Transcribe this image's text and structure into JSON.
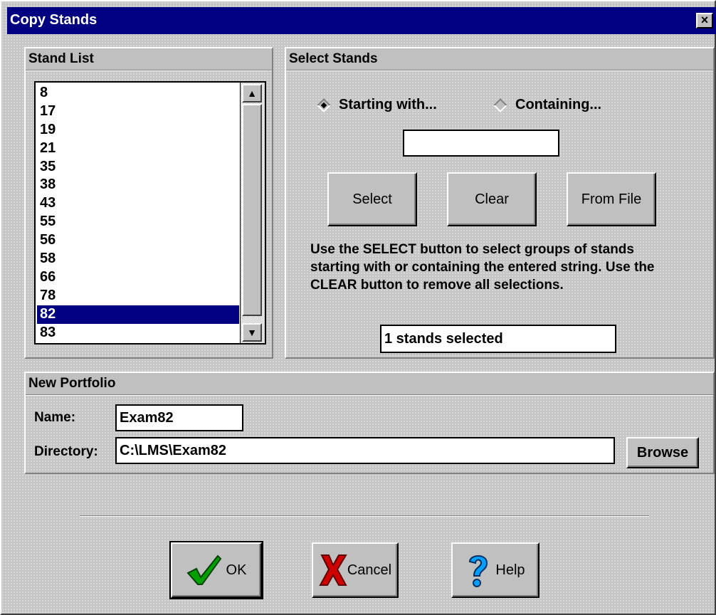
{
  "window": {
    "title": "Copy Stands",
    "close": "×"
  },
  "stand_list": {
    "header": "Stand List",
    "items": [
      "8",
      "17",
      "19",
      "21",
      "35",
      "38",
      "43",
      "55",
      "56",
      "58",
      "66",
      "78",
      "82",
      "83"
    ],
    "selected": "82"
  },
  "select_stands": {
    "header": "Select Stands",
    "radio_starting": "Starting with...",
    "radio_containing": "Containing...",
    "search_value": "",
    "select_label": "Select",
    "clear_label": "Clear",
    "from_file_label": "From File",
    "help_text": "Use the SELECT button to select groups of stands starting with or containing the entered string.  Use the CLEAR button to remove all selections.",
    "status": "1 stands selected"
  },
  "new_portfolio": {
    "header": "New Portfolio",
    "name_label": "Name:",
    "name_value": "Exam82",
    "directory_label": "Directory:",
    "directory_value": "C:\\LMS\\Exam82",
    "browse_label": "Browse"
  },
  "buttons": {
    "ok": "OK",
    "cancel": "Cancel",
    "help": "Help"
  }
}
